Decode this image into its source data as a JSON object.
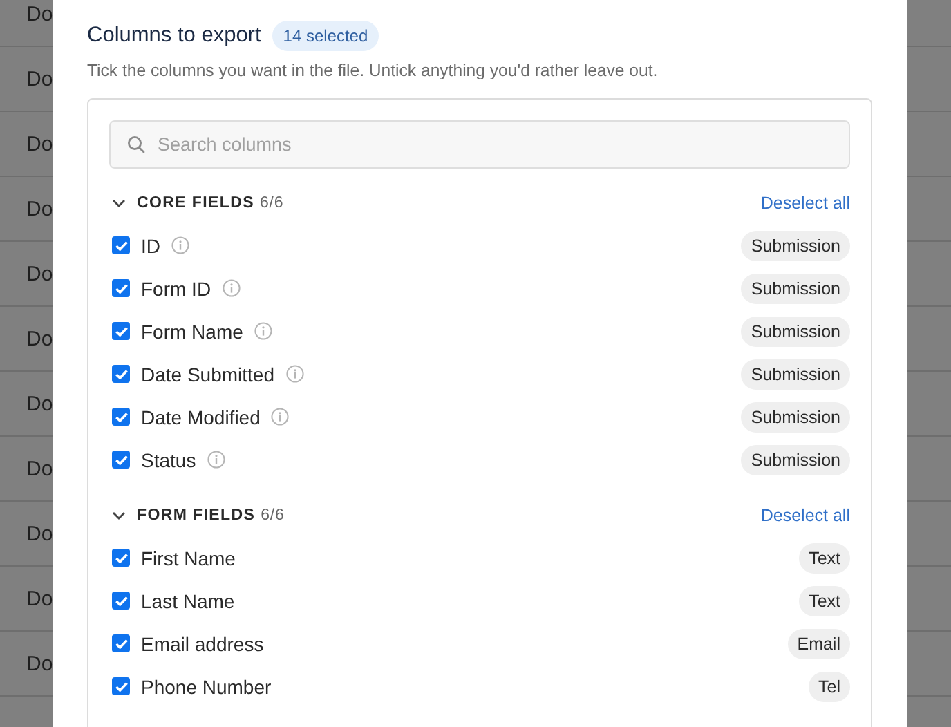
{
  "background_table": {
    "rows": [
      {
        "column_1": "Do"
      },
      {
        "column_1": "Do"
      },
      {
        "column_1": "Do"
      },
      {
        "column_1": "Do"
      },
      {
        "column_1": "Do"
      },
      {
        "column_1": "Do"
      },
      {
        "column_1": "Do"
      },
      {
        "column_1": "Do"
      },
      {
        "column_1": "Do"
      },
      {
        "column_1": "Do"
      },
      {
        "column_1": "Do"
      }
    ]
  },
  "dialog": {
    "title": "Columns to export",
    "badge": "14 selected",
    "description": "Tick the columns you want in the file. Untick anything you'd rather leave out.",
    "search": {
      "placeholder": "Search columns"
    },
    "sections": [
      {
        "title": "CORE FIELDS",
        "count": "6/6",
        "action": "Deselect all",
        "expanded": true,
        "items": [
          {
            "label": "ID",
            "info": true,
            "tag": "Submission",
            "checked": true
          },
          {
            "label": "Form ID",
            "info": true,
            "tag": "Submission",
            "checked": true
          },
          {
            "label": "Form Name",
            "info": true,
            "tag": "Submission",
            "checked": true
          },
          {
            "label": "Date Submitted",
            "info": true,
            "tag": "Submission",
            "checked": true
          },
          {
            "label": "Date Modified",
            "info": true,
            "tag": "Submission",
            "checked": true
          },
          {
            "label": "Status",
            "info": true,
            "tag": "Submission",
            "checked": true
          }
        ]
      },
      {
        "title": "FORM FIELDS",
        "count": "6/6",
        "action": "Deselect all",
        "expanded": true,
        "items": [
          {
            "label": "First Name",
            "info": false,
            "tag": "Text",
            "checked": true
          },
          {
            "label": "Last Name",
            "info": false,
            "tag": "Text",
            "checked": true
          },
          {
            "label": "Email address",
            "info": false,
            "tag": "Email",
            "checked": true
          },
          {
            "label": "Phone Number",
            "info": false,
            "tag": "Tel",
            "checked": true
          }
        ]
      }
    ]
  }
}
